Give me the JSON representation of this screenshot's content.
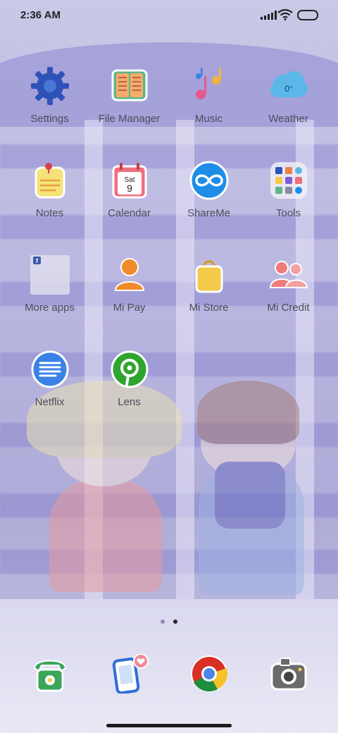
{
  "status_bar": {
    "time": "2:36 AM"
  },
  "apps": [
    {
      "label": "Settings",
      "icon": "gear-icon",
      "color": "#2f52b8"
    },
    {
      "label": "File Manager",
      "icon": "folder-book-icon",
      "color": "#e9834a"
    },
    {
      "label": "Music",
      "icon": "music-notes-icon",
      "color": "#e55a8e"
    },
    {
      "label": "Weather",
      "icon": "weather-cloud-icon",
      "color": "#59b8e8",
      "badge": "0°"
    },
    {
      "label": "Notes",
      "icon": "notes-icon",
      "color": "#f6e27a"
    },
    {
      "label": "Calendar",
      "icon": "calendar-icon",
      "color": "#ef6f7c",
      "badge_day": "Sat",
      "badge_date": "9"
    },
    {
      "label": "ShareMe",
      "icon": "shareme-icon",
      "color": "#1f8de8"
    },
    {
      "label": "Tools",
      "icon": "tools-folder-icon",
      "color": "#e8e8f0"
    },
    {
      "label": "More apps",
      "icon": "more-apps-folder-icon",
      "color": "#dcdbea"
    },
    {
      "label": "Mi Pay",
      "icon": "mi-pay-icon",
      "color": "#f08a2a"
    },
    {
      "label": "Mi Store",
      "icon": "shopping-bag-icon",
      "color": "#f5c94a"
    },
    {
      "label": "Mi Credit",
      "icon": "mi-credit-icon",
      "color": "#f07b7b"
    },
    {
      "label": "Netflix",
      "icon": "netflix-icon",
      "color": "#3a82e6"
    },
    {
      "label": "Lens",
      "icon": "lens-icon",
      "color": "#2fa52f"
    }
  ],
  "dock": [
    {
      "icon": "phone-icon",
      "color": "#3aa65a"
    },
    {
      "icon": "messages-icon",
      "color": "#2f6fd6"
    },
    {
      "icon": "chrome-icon",
      "color": "#d93025"
    },
    {
      "icon": "camera-icon",
      "color": "#6a6a6a"
    }
  ],
  "pages": {
    "count": 2,
    "active": 2
  }
}
